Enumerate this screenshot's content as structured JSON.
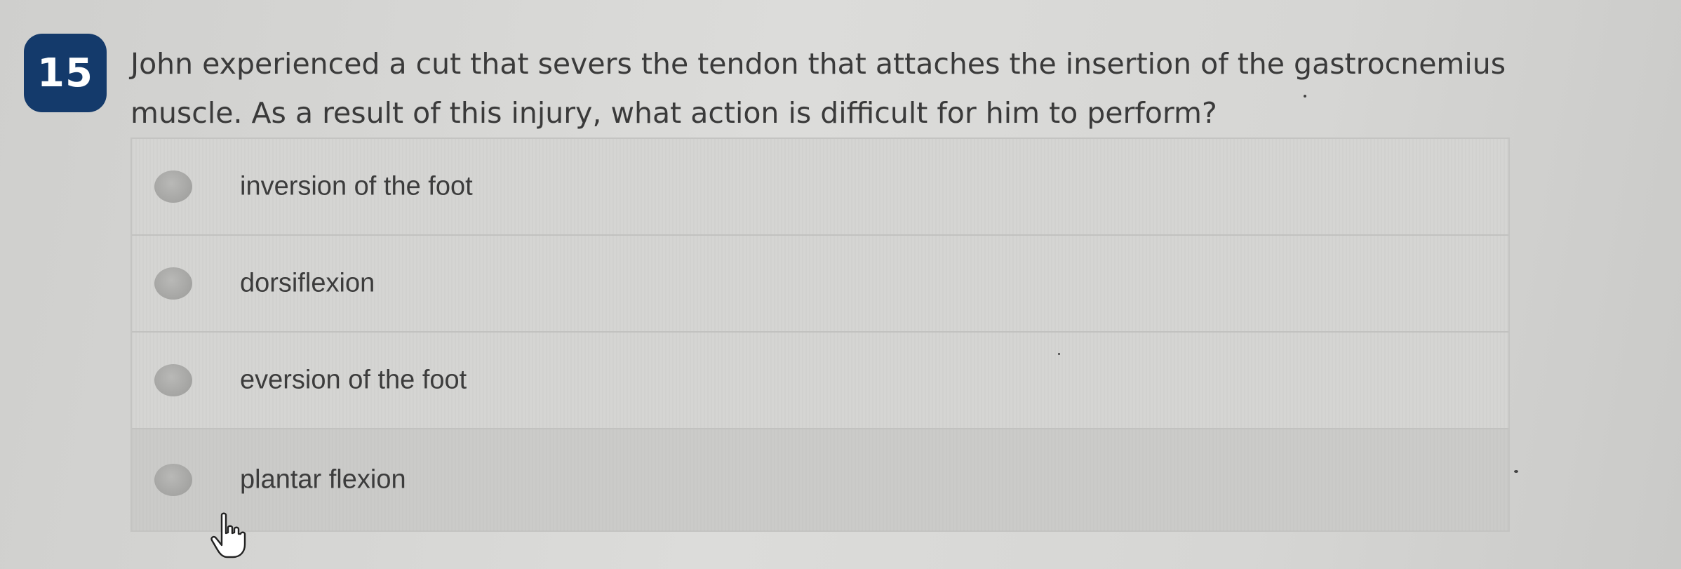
{
  "question": {
    "number": "15",
    "text": "John experienced a cut that severs the tendon that attaches the insertion of the gastrocnemius muscle. As a result of this injury, what action is difficult for him to perform?"
  },
  "options": [
    {
      "label": "inversion of the foot"
    },
    {
      "label": "dorsiflexion"
    },
    {
      "label": "eversion of the foot"
    },
    {
      "label": "plantar flexion"
    }
  ],
  "cursor": {
    "icon": "hand-pointer-icon",
    "hovered_option": "plantar flexion"
  },
  "colors": {
    "badge": "#143a6b",
    "text": "#3a3a3a",
    "radio": "#a8a8a6",
    "panel": "#d5d5d3"
  }
}
